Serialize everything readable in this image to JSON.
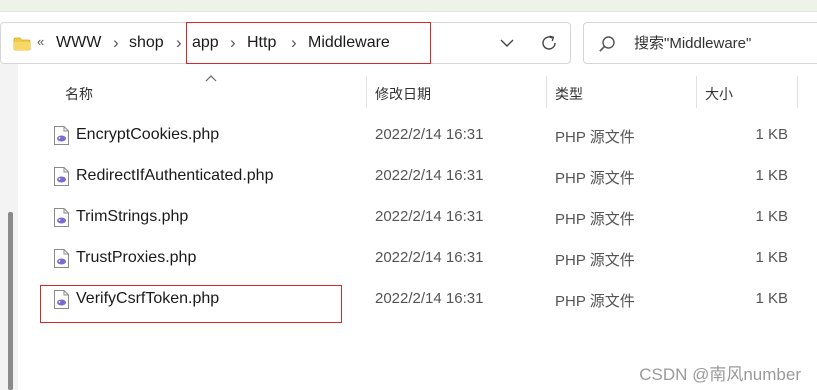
{
  "address_bar": {
    "overflow_label": "«",
    "crumbs": [
      "WWW",
      "shop",
      "app",
      "Http",
      "Middleware"
    ],
    "separator": "›"
  },
  "search": {
    "placeholder": "搜索\"Middleware\""
  },
  "columns": {
    "name": "名称",
    "modified": "修改日期",
    "type": "类型",
    "size": "大小"
  },
  "files": [
    {
      "name": "EncryptCookies.php",
      "modified": "2022/2/14 16:31",
      "type": "PHP 源文件",
      "size": "1 KB"
    },
    {
      "name": "RedirectIfAuthenticated.php",
      "modified": "2022/2/14 16:31",
      "type": "PHP 源文件",
      "size": "1 KB"
    },
    {
      "name": "TrimStrings.php",
      "modified": "2022/2/14 16:31",
      "type": "PHP 源文件",
      "size": "1 KB"
    },
    {
      "name": "TrustProxies.php",
      "modified": "2022/2/14 16:31",
      "type": "PHP 源文件",
      "size": "1 KB"
    },
    {
      "name": "VerifyCsrfToken.php",
      "modified": "2022/2/14 16:31",
      "type": "PHP 源文件",
      "size": "1 KB"
    }
  ],
  "watermark": "CSDN @南风number",
  "colors": {
    "highlight": "#d62828",
    "folder": "#f2c84b",
    "php_icon": "#7a6bd1"
  }
}
